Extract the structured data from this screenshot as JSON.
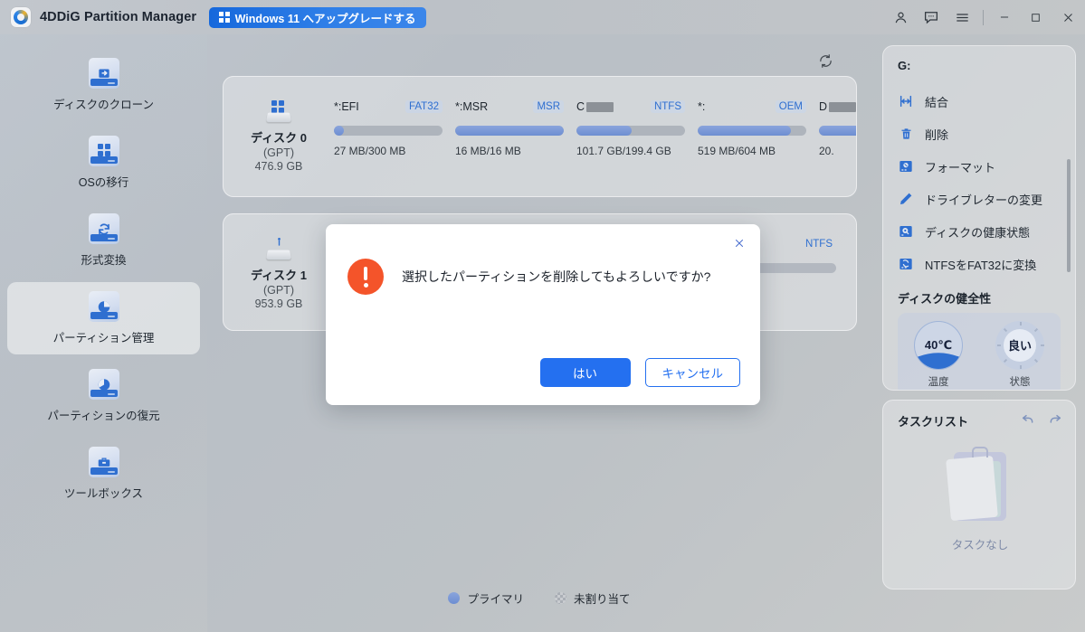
{
  "titlebar": {
    "app_title": "4DDiG Partition Manager",
    "upgrade_badge": "Windows 11 へアップグレードする",
    "logo_icon": "4ddig-logo-icon",
    "windows_icon": "windows-logo-icon",
    "account_icon": "account-icon",
    "feedback_icon": "feedback-chat-icon",
    "menu_icon": "hamburger-menu-icon",
    "minimize_icon": "minimize-icon",
    "maximize_icon": "maximize-icon",
    "close_icon": "close-icon"
  },
  "sidebar": {
    "items": [
      {
        "label": "ディスクのクローン",
        "icon": "disk-clone-icon",
        "active": false
      },
      {
        "label": "OSの移行",
        "icon": "os-migration-icon",
        "active": false
      },
      {
        "label": "形式変換",
        "icon": "format-convert-icon",
        "active": false
      },
      {
        "label": "パーティション管理",
        "icon": "partition-manage-icon",
        "active": true
      },
      {
        "label": "パーティションの復元",
        "icon": "partition-recover-icon",
        "active": false
      },
      {
        "label": "ツールボックス",
        "icon": "toolbox-icon",
        "active": false
      }
    ]
  },
  "main": {
    "refresh_icon": "refresh-icon",
    "disks": [
      {
        "name": "ディスク 0",
        "scheme": "(GPT)",
        "capacity": "476.9 GB",
        "icon": "hard-disk-icon",
        "partitions": [
          {
            "label": "*:EFI",
            "redacted": false,
            "fs": "FAT32",
            "size": "27 MB/300 MB",
            "fill_pct": 9
          },
          {
            "label": "*:MSR",
            "redacted": false,
            "fs": "MSR",
            "size": "16 MB/16 MB",
            "fill_pct": 100
          },
          {
            "label": "C",
            "redacted": true,
            "fs": "NTFS",
            "size": "101.7 GB/199.4 GB",
            "fill_pct": 51
          },
          {
            "label": "*:",
            "redacted": false,
            "fs": "OEM",
            "size": "519 MB/604 MB",
            "fill_pct": 86
          },
          {
            "label": "D",
            "redacted": true,
            "fs": "",
            "size": "20.",
            "fill_pct": 100
          }
        ]
      },
      {
        "name": "ディスク 1",
        "scheme": "(GPT)",
        "capacity": "953.9 GB",
        "icon": "usb-disk-icon",
        "partitions": [
          {
            "label": "",
            "redacted": false,
            "fs": "NTFS",
            "size": "",
            "fill_pct": 0
          }
        ]
      }
    ],
    "legend": [
      {
        "label": "プライマリ",
        "swatch": "primary"
      },
      {
        "label": "未割り当て",
        "swatch": "unallocated"
      }
    ]
  },
  "right_panel": {
    "drive_letter": "G:",
    "actions": [
      {
        "label": "結合",
        "icon": "merge-icon"
      },
      {
        "label": "削除",
        "icon": "trash-delete-icon"
      },
      {
        "label": "フォーマット",
        "icon": "format-disk-icon"
      },
      {
        "label": "ドライブレターの変更",
        "icon": "pencil-edit-icon"
      },
      {
        "label": "ディスクの健康状態",
        "icon": "disk-health-icon"
      },
      {
        "label": "NTFSをFAT32に変換",
        "icon": "convert-fs-icon"
      }
    ],
    "health_title": "ディスクの健全性",
    "gauges": [
      {
        "value": "40℃",
        "caption": "温度",
        "type": "temperature"
      },
      {
        "value": "良い",
        "caption": "状態",
        "type": "status"
      }
    ],
    "tasks": {
      "title": "タスクリスト",
      "undo_icon": "undo-arrow-icon",
      "redo_icon": "redo-arrow-icon",
      "empty_icon": "clipboard-empty-icon",
      "empty_label": "タスクなし"
    }
  },
  "modal": {
    "message": "選択したパーティションを削除してもよろしいですか?",
    "warning_icon": "warning-exclamation-icon",
    "close_icon": "close-icon",
    "confirm_label": "はい",
    "cancel_label": "キャンセル"
  },
  "colors": {
    "accent": "#2470f0",
    "warning": "#f4542a",
    "link": "#2f6fd0",
    "bar_fill": "#6d8ed2"
  }
}
